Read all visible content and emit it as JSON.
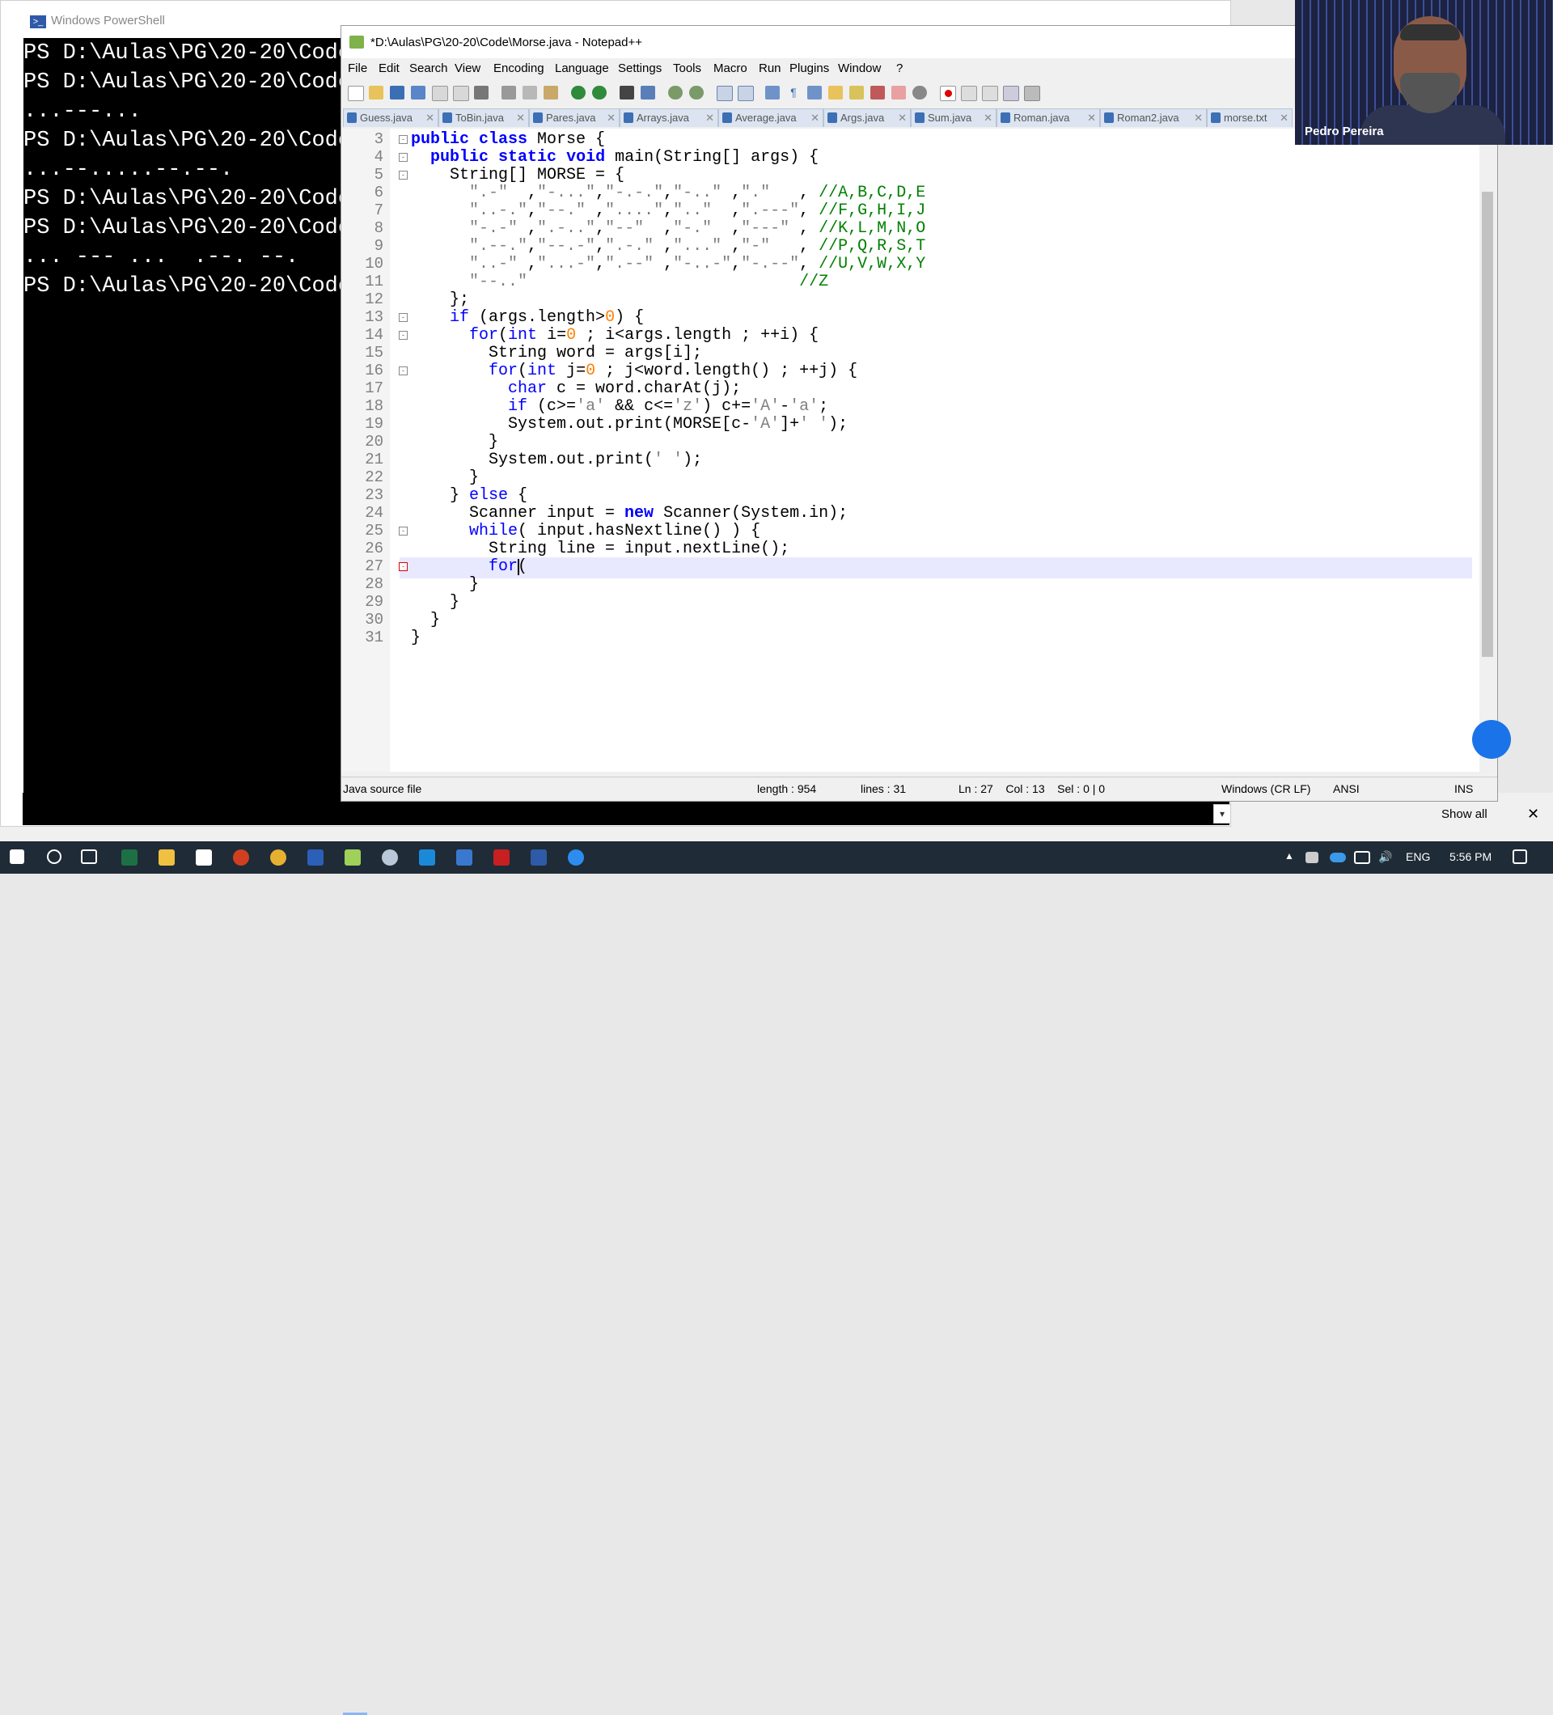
{
  "powershell": {
    "title": "Windows PowerShell",
    "lines": [
      "PS D:\\Aulas\\PG\\20-20\\Code",
      "PS D:\\Aulas\\PG\\20-20\\Code",
      "...---...",
      "PS D:\\Aulas\\PG\\20-20\\Code",
      "...--.....--.--.",
      "PS D:\\Aulas\\PG\\20-20\\Code",
      "PS D:\\Aulas\\PG\\20-20\\Code",
      "... --- ...  .--. --.",
      "PS D:\\Aulas\\PG\\20-20\\Code"
    ]
  },
  "notepad": {
    "title": "*D:\\Aulas\\PG\\20-20\\Code\\Morse.java - Notepad++",
    "menu": [
      "File",
      "Edit",
      "Search",
      "View",
      "Encoding",
      "Language",
      "Settings",
      "Tools",
      "Macro",
      "Run",
      "Plugins",
      "Window",
      "?"
    ],
    "tabs": [
      "Guess.java",
      "ToBin.java",
      "Pares.java",
      "Arrays.java",
      "Average.java",
      "Args.java",
      "Sum.java",
      "Roman.java",
      "Roman2.java",
      "morse.txt"
    ],
    "code": [
      {
        "n": "3",
        "t": "public class Morse {"
      },
      {
        "n": "4",
        "t": "  public static void main(String[] args) {"
      },
      {
        "n": "5",
        "t": "    String[] MORSE = {"
      },
      {
        "n": "6",
        "t": "      \".-\"  ,\"-...\",\"-.-.\",\"-..\" ,\".\"   , //A,B,C,D,E"
      },
      {
        "n": "7",
        "t": "      \"..-.\",\"--.\" ,\"....\",\"..\"  ,\".---\", //F,G,H,I,J"
      },
      {
        "n": "8",
        "t": "      \"-.-\" ,\".-..\",\"--\"  ,\"-.\"  ,\"---\" , //K,L,M,N,O"
      },
      {
        "n": "9",
        "t": "      \".--.\",\"--.-\",\".-.\" ,\"...\" ,\"-\"   , //P,Q,R,S,T"
      },
      {
        "n": "10",
        "t": "      \"..-\" ,\"...-\",\".--\" ,\"-..-\",\"-.--\", //U,V,W,X,Y"
      },
      {
        "n": "11",
        "t": "      \"--..\"                            //Z"
      },
      {
        "n": "12",
        "t": "    };"
      },
      {
        "n": "13",
        "t": "    if (args.length>0) {"
      },
      {
        "n": "14",
        "t": "      for(int i=0 ; i<args.length ; ++i) {"
      },
      {
        "n": "15",
        "t": "        String word = args[i];"
      },
      {
        "n": "16",
        "t": "        for(int j=0 ; j<word.length() ; ++j) {"
      },
      {
        "n": "17",
        "t": "          char c = word.charAt(j);"
      },
      {
        "n": "18",
        "t": "          if (c>='a' && c<='z') c+='A'-'a';"
      },
      {
        "n": "19",
        "t": "          System.out.print(MORSE[c-'A']+' ');"
      },
      {
        "n": "20",
        "t": "        }"
      },
      {
        "n": "21",
        "t": "        System.out.print(' ');"
      },
      {
        "n": "22",
        "t": "      }"
      },
      {
        "n": "23",
        "t": "    } else {"
      },
      {
        "n": "24",
        "t": "      Scanner input = new Scanner(System.in);"
      },
      {
        "n": "25",
        "t": "      while( input.hasNextline() ) {"
      },
      {
        "n": "26",
        "t": "        String line = input.nextLine();"
      },
      {
        "n": "27",
        "t": "        for("
      },
      {
        "n": "28",
        "t": "      }"
      },
      {
        "n": "29",
        "t": "    }"
      },
      {
        "n": "30",
        "t": "  }"
      },
      {
        "n": "31",
        "t": "}"
      }
    ],
    "status": {
      "file_type": "Java source file",
      "length": "length : 954",
      "lines": "lines : 31",
      "position": "Ln : 27    Col : 13    Sel : 0 | 0",
      "eol": "Windows (CR LF)",
      "encoding": "ANSI",
      "mode": "INS"
    }
  },
  "webcam": {
    "name": "Pedro Pereira"
  },
  "notifications": {
    "show_all": "Show all"
  },
  "taskbar": {
    "lang": "ENG",
    "time": "5:56 PM"
  },
  "colors": {
    "keyword": "#0000ff",
    "string": "#808080",
    "number": "#ff8000",
    "comment": "#008000",
    "taskbar": "#1f2b36"
  }
}
